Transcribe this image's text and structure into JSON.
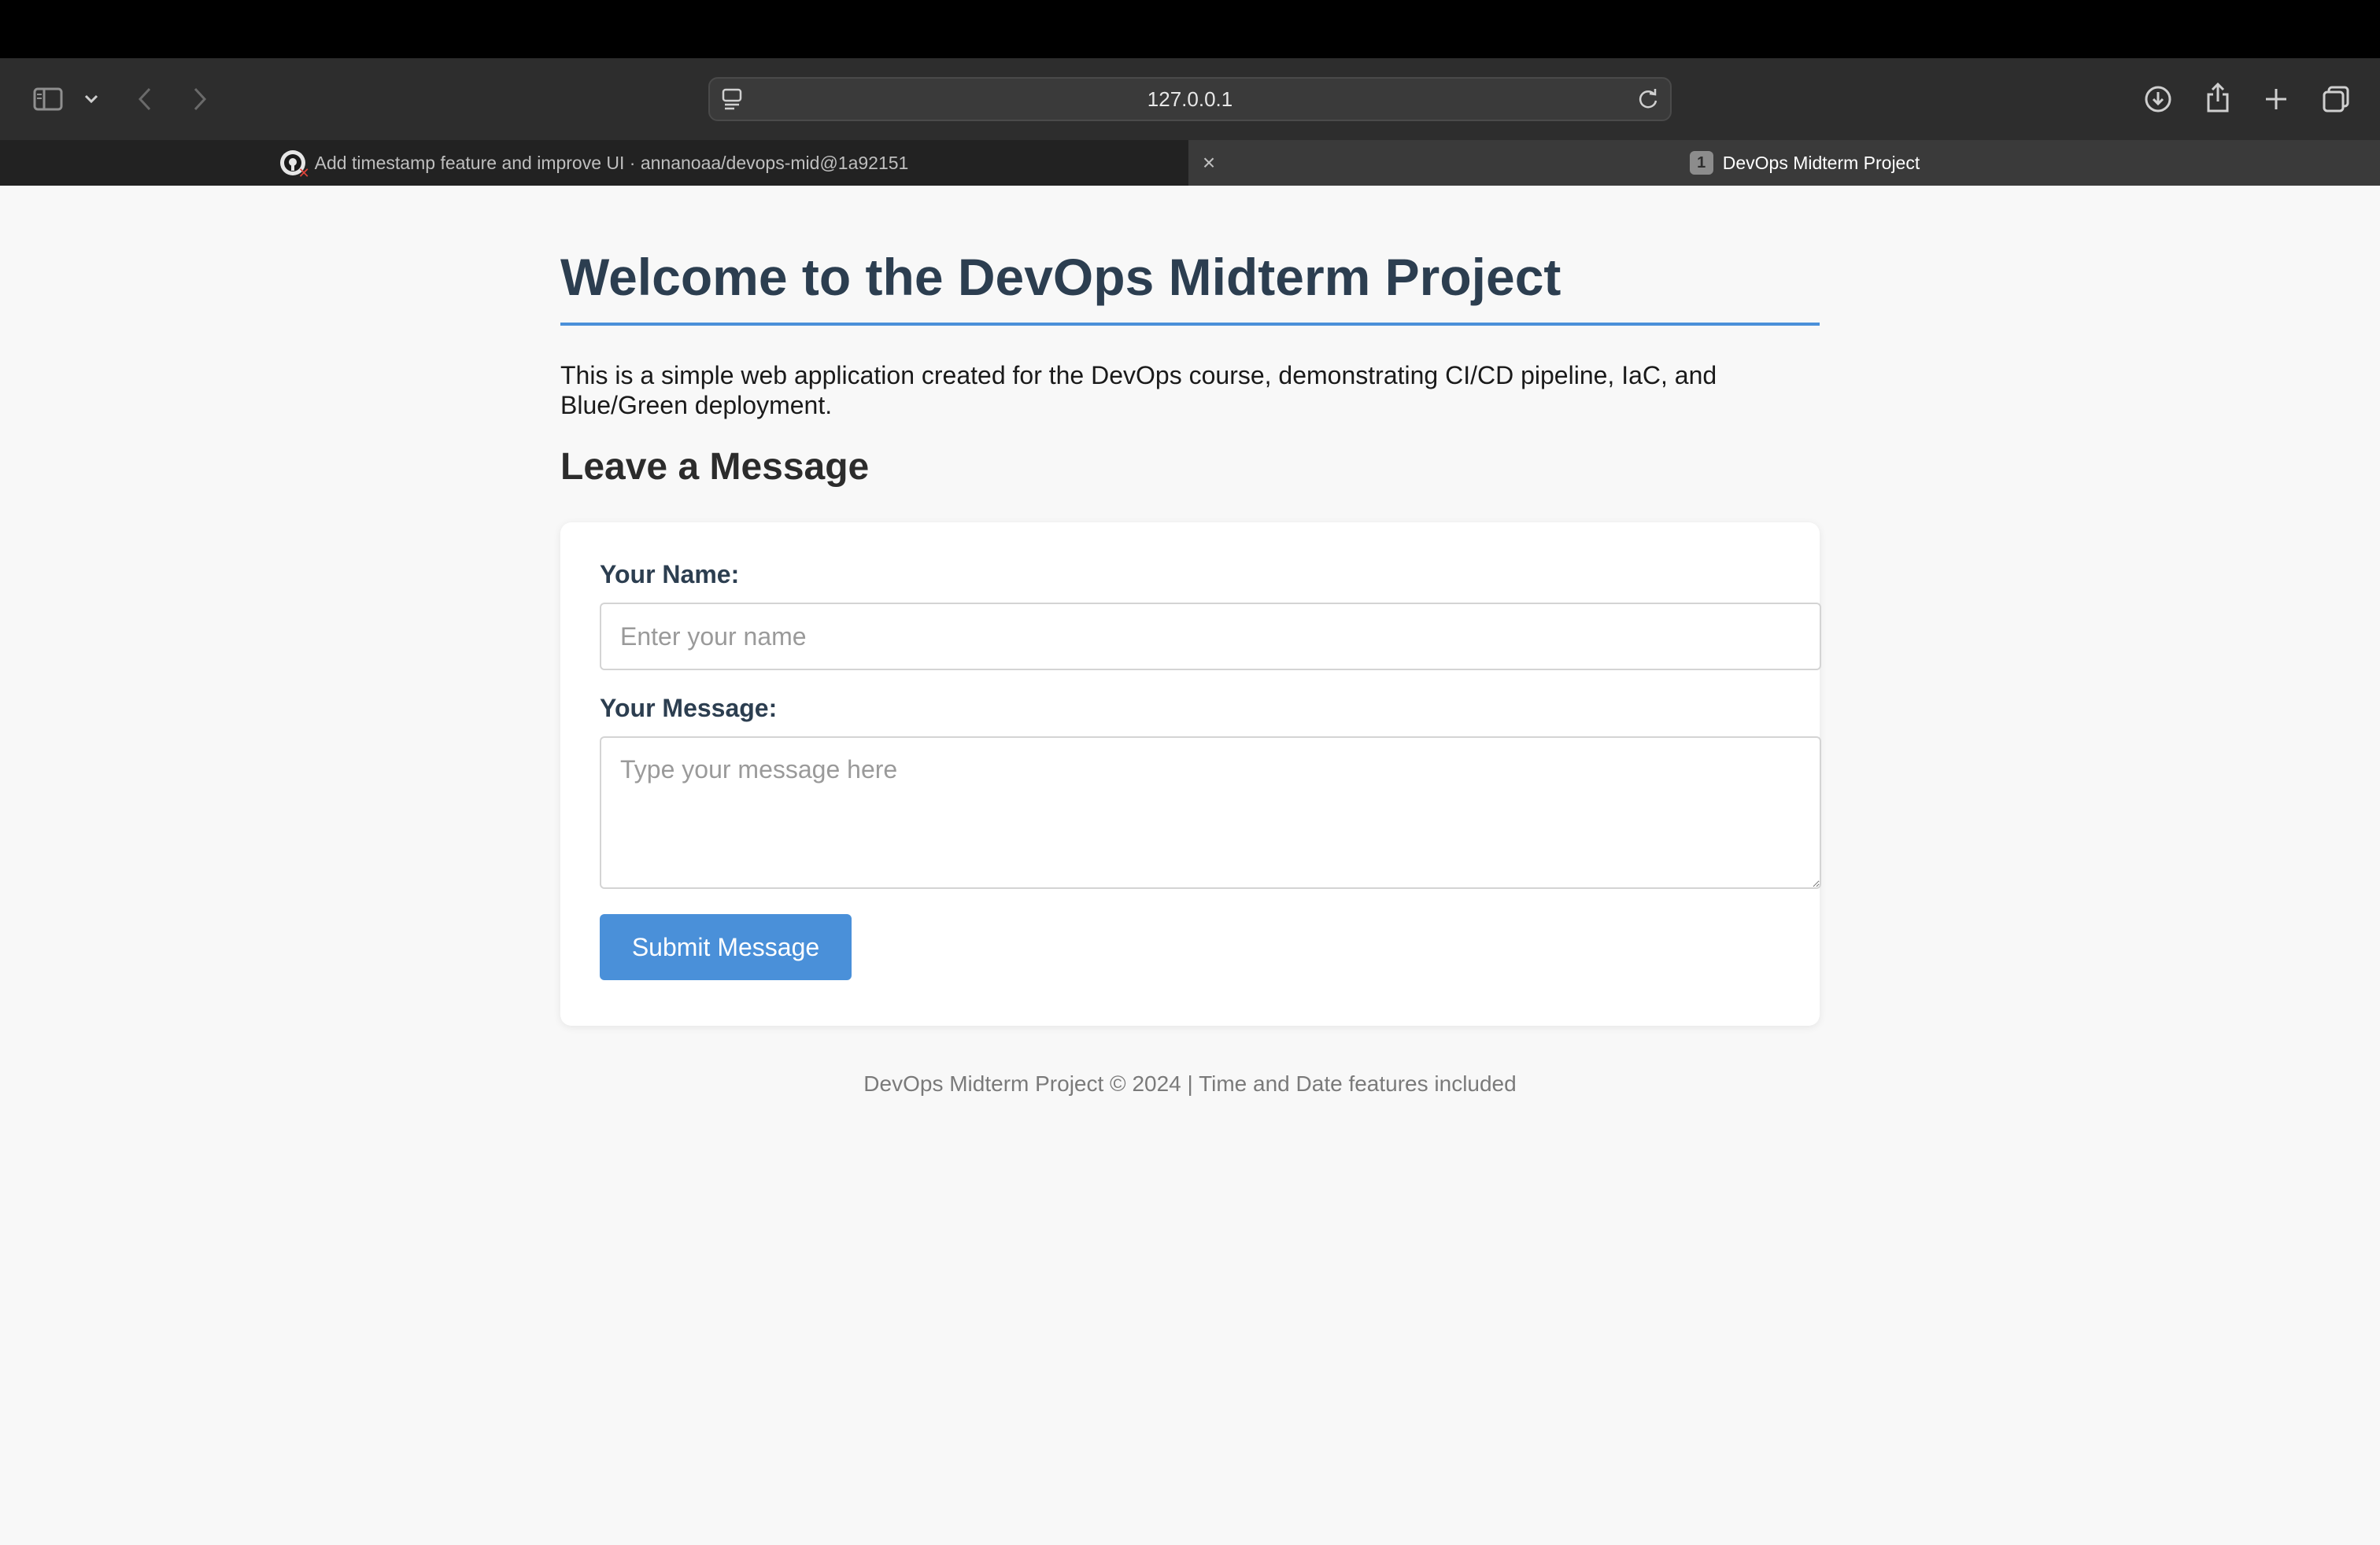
{
  "browser": {
    "address": "127.0.0.1",
    "tabs": [
      {
        "title": "Add timestamp feature and improve UI · annanoaa/devops-mid@1a92151",
        "icon": "github-icon",
        "active": false
      },
      {
        "title": "DevOps Midterm Project",
        "badge": "1",
        "active": true
      }
    ],
    "toolbar_icons": [
      "sidebar-icon",
      "chevron-down-icon",
      "back-arrow-icon",
      "forward-arrow-icon",
      "page-settings-icon",
      "reload-icon",
      "download-icon",
      "share-icon",
      "new-tab-icon",
      "tab-overview-icon"
    ],
    "close_tab_symbol": "×"
  },
  "page": {
    "title": "Welcome to the DevOps Midterm Project",
    "intro": "This is a simple web application created for the DevOps course, demonstrating CI/CD pipeline, IaC, and Blue/Green deployment.",
    "section_heading": "Leave a Message",
    "form": {
      "name_label": "Your Name:",
      "name_placeholder": "Enter your name",
      "name_value": "",
      "message_label": "Your Message:",
      "message_placeholder": "Type your message here",
      "message_value": "",
      "submit_label": "Submit Message"
    },
    "footer": "DevOps Midterm Project © 2024 | Time and Date features included"
  },
  "colors": {
    "accent": "#4a90d9",
    "title": "#2c3e50",
    "page_background": "#f8f8f8",
    "chrome_dark": "#2d2d2d"
  }
}
